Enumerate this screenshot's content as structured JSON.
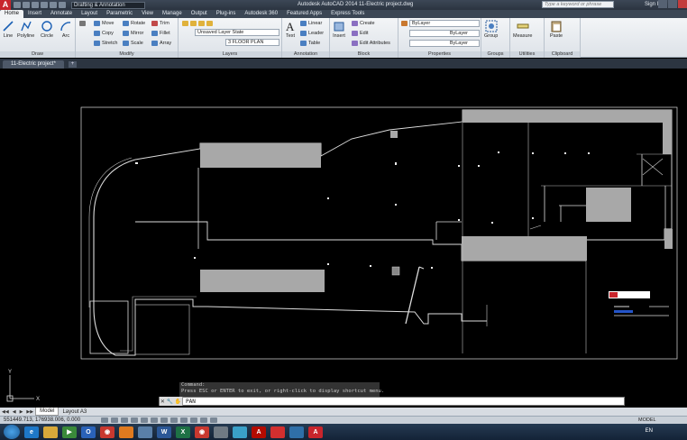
{
  "titlebar": {
    "workspace": "Drafting & Annotation",
    "title": "Autodesk AutoCAD 2014   11-Electric project.dwg",
    "search_placeholder": "Type a keyword or phrase",
    "signin": "Sign In"
  },
  "ribbon_tabs": [
    "Home",
    "Insert",
    "Annotate",
    "Layout",
    "Parametric",
    "View",
    "Manage",
    "Output",
    "Plug-ins",
    "Autodesk 360",
    "Featured Apps",
    "Express Tools"
  ],
  "draw": {
    "line": "Line",
    "polyline": "Polyline",
    "circle": "Circle",
    "arc": "Arc",
    "title": "Draw"
  },
  "modify": {
    "move": "Move",
    "rotate": "Rotate",
    "trim": "Trim",
    "copy": "Copy",
    "mirror": "Mirror",
    "fillet": "Fillet",
    "stretch": "Stretch",
    "scale": "Scale",
    "array": "Array",
    "title": "Modify"
  },
  "layers": {
    "layer_state": "Unsaved Layer State",
    "current_layer": "3 FLOOR PLAN",
    "title": "Layers"
  },
  "annotation": {
    "text": "Text",
    "linear": "Linear",
    "leader": "Leader",
    "table": "Table",
    "title": "Annotation"
  },
  "block": {
    "insert": "Insert",
    "create": "Create",
    "edit": "Edit",
    "edit_attributes": "Edit Attributes",
    "title": "Block"
  },
  "properties": {
    "color": "ByLayer",
    "linetype": "ByLayer",
    "lineweight": "ByLayer",
    "title": "Properties"
  },
  "groups": {
    "group": "Group",
    "title": "Groups"
  },
  "utilities": {
    "measure": "Measure",
    "title": "Utilities"
  },
  "clipboard": {
    "paste": "Paste",
    "title": "Clipboard"
  },
  "document_tab": "11-Electric project*",
  "command": {
    "history_1": "Command:",
    "history_2": "Press ESC or ENTER to exit, or right-click to display shortcut menu.",
    "current": "PAN"
  },
  "layout_tabs": [
    "Model",
    "Layout A3"
  ],
  "status": {
    "coordinates": "551449.713, 176938.006, 0.000",
    "mode": "MODEL"
  },
  "taskbar": {
    "lang": "EN",
    "apps": [
      "Internet Explorer",
      "File Explorer",
      "Media Player",
      "Outlook",
      "Chrome",
      "Firefox",
      "Notepad",
      "Word",
      "Excel",
      "Chrome",
      "Calculator",
      "Paint",
      "Acrobat",
      "Adobe",
      "Network",
      "AutoCAD"
    ]
  },
  "colors": {
    "accent": "#c8252c",
    "drawing_background": "#000000",
    "wall_fill": "#a8a8a8"
  }
}
